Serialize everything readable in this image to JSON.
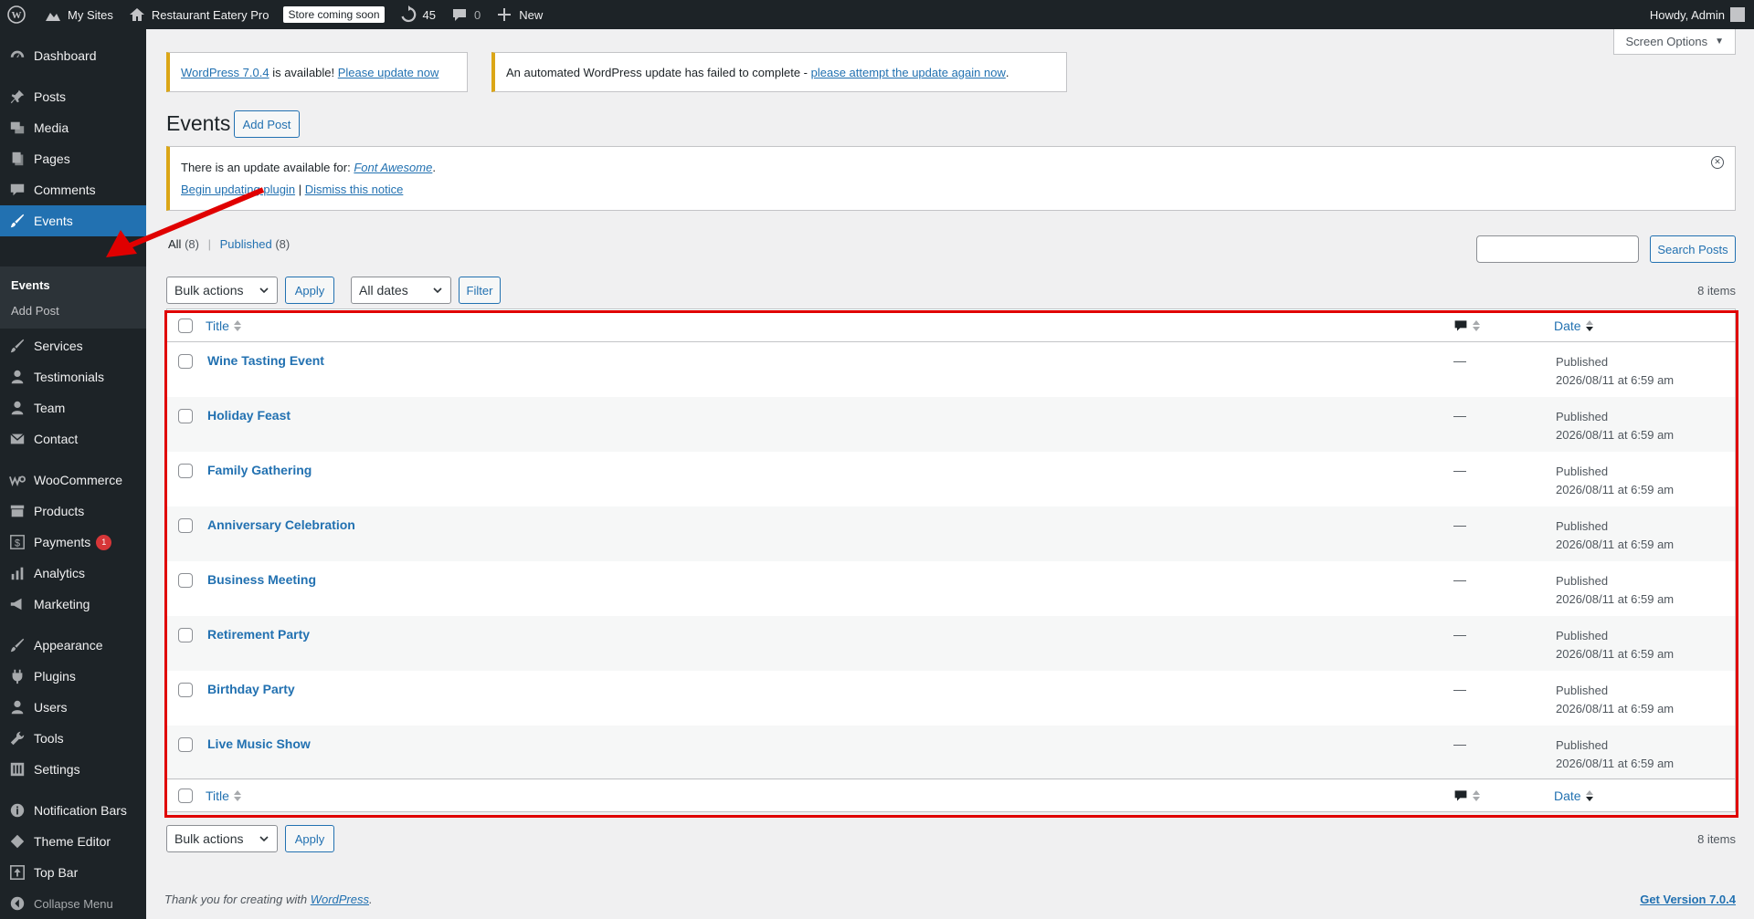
{
  "adminbar": {
    "my_sites": "My Sites",
    "site_name": "Restaurant Eatery Pro",
    "store_badge": "Store coming soon",
    "updates_count": "45",
    "comments_count": "0",
    "new_label": "New",
    "howdy": "Howdy, Admin"
  },
  "sidebar": {
    "items": [
      {
        "label": "Dashboard",
        "icon": "dashboard-icon"
      },
      {
        "label": "Posts",
        "icon": "pin-icon"
      },
      {
        "label": "Media",
        "icon": "media-icon"
      },
      {
        "label": "Pages",
        "icon": "pages-icon"
      },
      {
        "label": "Comments",
        "icon": "comment-icon"
      },
      {
        "label": "Events",
        "icon": "brush-icon"
      },
      {
        "label": "Services",
        "icon": "brush-icon"
      },
      {
        "label": "Testimonials",
        "icon": "user-icon"
      },
      {
        "label": "Team",
        "icon": "user-icon"
      },
      {
        "label": "Contact",
        "icon": "mail-icon"
      },
      {
        "label": "WooCommerce",
        "icon": "woo-icon"
      },
      {
        "label": "Products",
        "icon": "archive-icon"
      },
      {
        "label": "Payments",
        "icon": "dollar-icon",
        "badge": "1"
      },
      {
        "label": "Analytics",
        "icon": "bar-chart-icon"
      },
      {
        "label": "Marketing",
        "icon": "megaphone-icon"
      },
      {
        "label": "Appearance",
        "icon": "brush-icon"
      },
      {
        "label": "Plugins",
        "icon": "plug-icon"
      },
      {
        "label": "Users",
        "icon": "user-icon"
      },
      {
        "label": "Tools",
        "icon": "wrench-icon"
      },
      {
        "label": "Settings",
        "icon": "sliders-icon"
      },
      {
        "label": "Notification Bars",
        "icon": "info-icon"
      },
      {
        "label": "Theme Editor",
        "icon": "diamond-icon"
      },
      {
        "label": "Top Bar",
        "icon": "arrow-up-box-icon"
      }
    ],
    "submenu": {
      "events": "Events",
      "add_post": "Add Post"
    },
    "collapse": "Collapse Menu"
  },
  "screen_options": "Screen Options",
  "notices": {
    "update_link": "WordPress 7.0.4",
    "update_text": " is available! ",
    "update_now": "Please update now",
    "auto_fail_text": "An automated WordPress update has failed to complete - ",
    "auto_fail_link": "please attempt the update again now",
    "plugin_text": "There is an update available for: ",
    "plugin_name": "Font Awesome",
    "begin_update": "Begin updating plugin",
    "dismiss": "Dismiss this notice",
    "sep": "|"
  },
  "page": {
    "title": "Events",
    "add_post": "Add Post"
  },
  "filters": {
    "all_label": "All",
    "all_count": "(8)",
    "published_label": "Published",
    "published_count": "(8)",
    "sep": "|",
    "bulk_actions": "Bulk actions",
    "apply": "Apply",
    "all_dates": "All dates",
    "filter": "Filter",
    "search_button": "Search Posts",
    "search_value": "",
    "items_count": "8 items"
  },
  "table": {
    "col_title": "Title",
    "col_date": "Date",
    "rows": [
      {
        "title": "Wine Tasting Event",
        "comments": "—",
        "status": "Published",
        "date": "2026/08/11 at 6:59 am"
      },
      {
        "title": "Holiday Feast",
        "comments": "—",
        "status": "Published",
        "date": "2026/08/11 at 6:59 am"
      },
      {
        "title": "Family Gathering",
        "comments": "—",
        "status": "Published",
        "date": "2026/08/11 at 6:59 am"
      },
      {
        "title": "Anniversary Celebration",
        "comments": "—",
        "status": "Published",
        "date": "2026/08/11 at 6:59 am"
      },
      {
        "title": "Business Meeting",
        "comments": "—",
        "status": "Published",
        "date": "2026/08/11 at 6:59 am"
      },
      {
        "title": "Retirement Party",
        "comments": "—",
        "status": "Published",
        "date": "2026/08/11 at 6:59 am"
      },
      {
        "title": "Birthday Party",
        "comments": "—",
        "status": "Published",
        "date": "2026/08/11 at 6:59 am"
      },
      {
        "title": "Live Music Show",
        "comments": "—",
        "status": "Published",
        "date": "2026/08/11 at 6:59 am"
      }
    ]
  },
  "footer": {
    "thanks_text": "Thank you for creating with ",
    "wordpress_link": "WordPress",
    "thanks_end": ".",
    "version": "Get Version 7.0.4"
  },
  "colors": {
    "admin_dark": "#1d2327",
    "accent": "#2271b1",
    "notice_warning": "#dba617",
    "annotation_red": "#e00000"
  }
}
